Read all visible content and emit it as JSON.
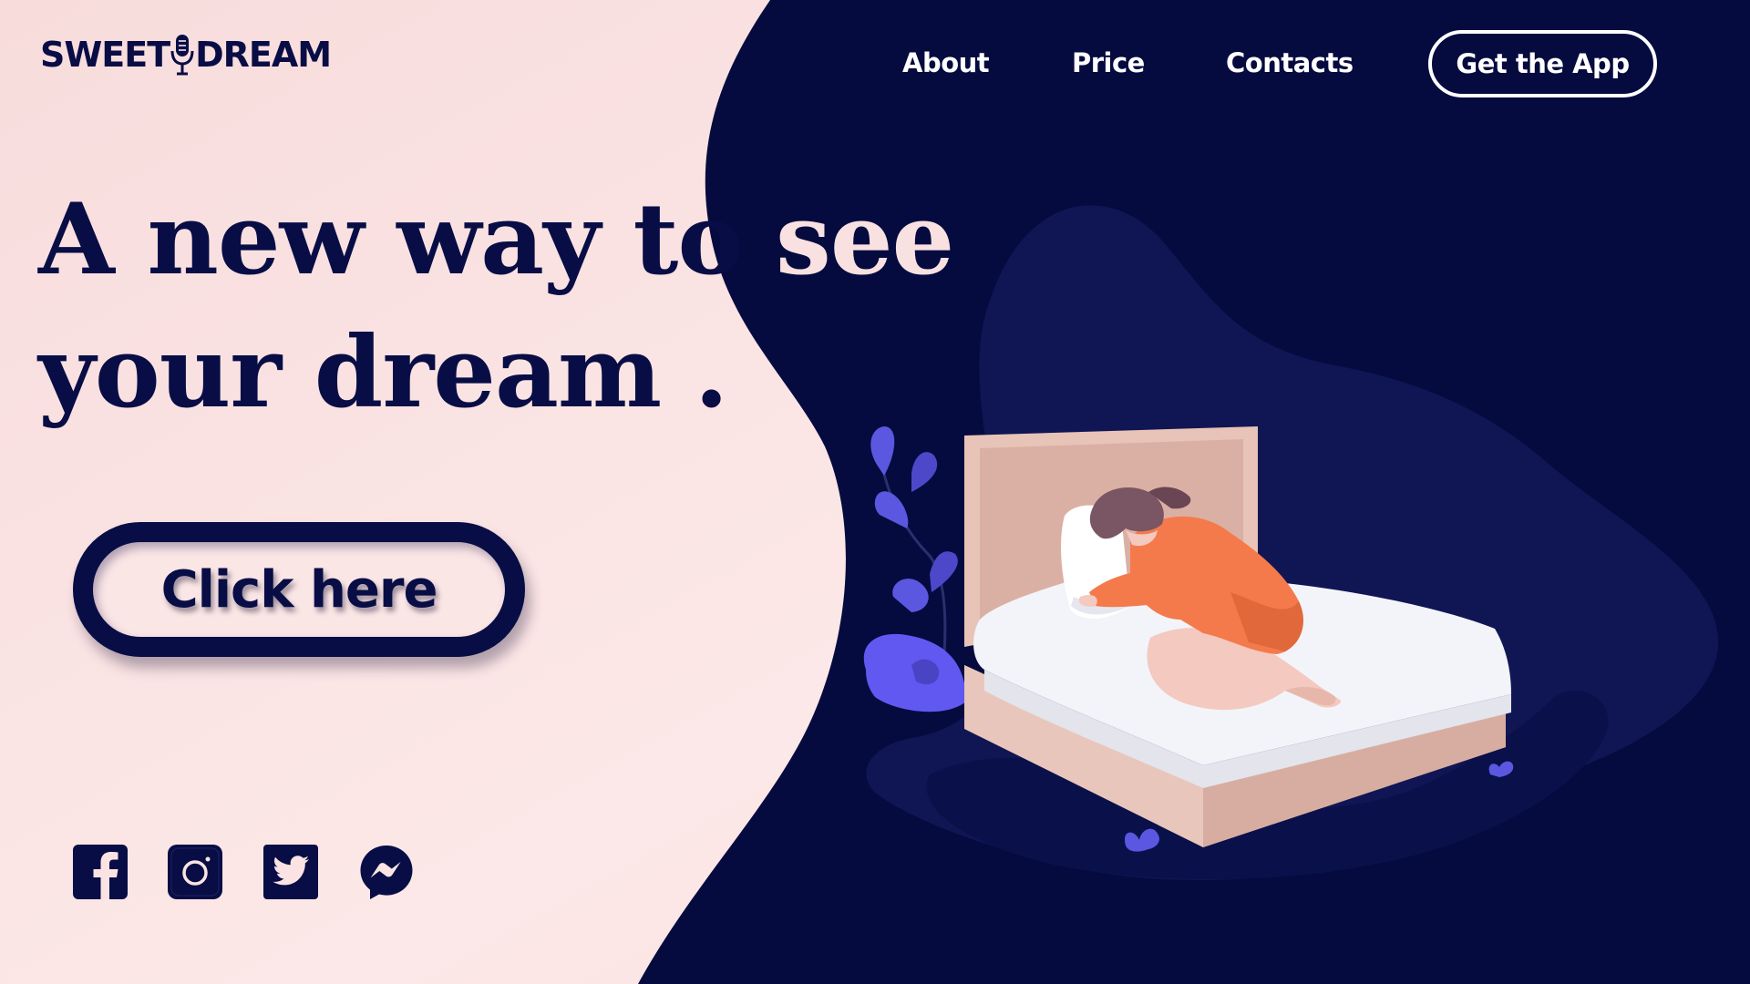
{
  "brand": {
    "name_part1": "SWEET",
    "name_part2": "DREAM",
    "icon": "microphone-icon"
  },
  "nav": {
    "items": [
      {
        "label": "About"
      },
      {
        "label": "Price"
      },
      {
        "label": "Contacts"
      }
    ],
    "cta_label": "Get the App"
  },
  "hero": {
    "line1_dark": "A new way to",
    "line1_light": " see",
    "line2": "your dream ."
  },
  "cta": {
    "label": "Click here"
  },
  "social": [
    {
      "icon": "facebook-icon"
    },
    {
      "icon": "instagram-icon"
    },
    {
      "icon": "twitter-icon"
    },
    {
      "icon": "messenger-icon"
    }
  ],
  "colors": {
    "navy": "#050b3f",
    "blush": "#fbe3e3",
    "white": "#ffffff",
    "accent_purple": "#5b57e0",
    "orange": "#f47a4c"
  }
}
